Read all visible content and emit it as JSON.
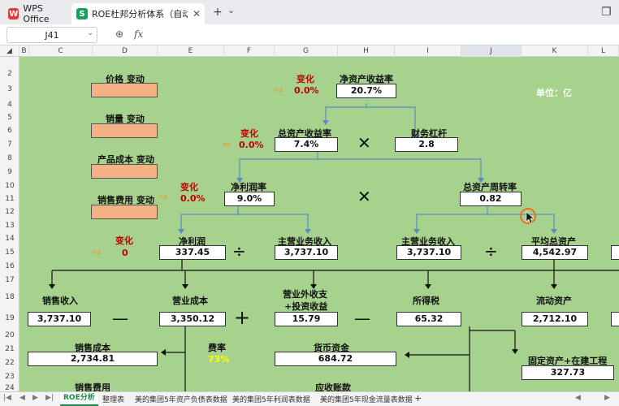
{
  "titlebar": {
    "app_tab": "WPS Office",
    "doc_tab": "ROE杜邦分析体系（自动计算+数",
    "new_tab": "+",
    "dropdown": "⌄",
    "window_icon": "❐"
  },
  "formulabar": {
    "cell_ref": "J41",
    "zoom_icon": "⊕",
    "fx_label": "fx"
  },
  "columns": [
    "B",
    "C",
    "D",
    "E",
    "F",
    "G",
    "H",
    "I",
    "J",
    "K",
    "L"
  ],
  "rows": [
    "2",
    "3",
    "4",
    "5",
    "6",
    "7",
    "8",
    "9",
    "10",
    "11",
    "12",
    "13",
    "14",
    "15",
    "16",
    "17",
    "18",
    "19",
    "20",
    "21",
    "22",
    "23",
    "24"
  ],
  "sheet": {
    "price_change_label": "价格 变动",
    "volume_change_label": "销量 变动",
    "cost_change_label": "产品成本 变动",
    "selling_change_label": "销售费用 变动",
    "change_label": "变化",
    "roe_change": "0.0%",
    "roa_change": "0.0%",
    "npm_change": "0.0%",
    "np_change": "0",
    "roe_label": "净资产收益率",
    "roe_value": "20.7%",
    "unit_label": "单位：亿",
    "roa_label": "总资产收益率",
    "roa_value": "7.4%",
    "leverage_label": "财务杠杆",
    "leverage_value": "2.8",
    "npm_label": "净利润率",
    "npm_value": "9.0%",
    "turnover_label": "总资产周转率",
    "turnover_value": "0.82",
    "np_label": "净利润",
    "np_value": "337.45",
    "rev1_label": "主营业务收入",
    "rev1_value": "3,737.10",
    "rev2_label": "主营业务收入",
    "rev2_value": "3,737.10",
    "avg_assets_label": "平均总资产",
    "avg_assets_value": "4,542.97",
    "sales_label": "销售收入",
    "sales_value": "3,737.10",
    "opcost_label": "营业成本",
    "opcost_value": "3,350.12",
    "nonop_label1": "营业外收支",
    "nonop_label2": "+投资收益",
    "nonop_value": "15.79",
    "tax_label": "所得税",
    "tax_value": "65.32",
    "current_assets_label": "流动资产",
    "current_assets_value": "2,712.10",
    "cogs_label": "销售成本",
    "cogs_value": "2,734.81",
    "rate_label": "费率",
    "rate_value": "73%",
    "cash_label": "货币资金",
    "cash_value": "684.72",
    "fixed_assets_label": "固定资产+在建工程",
    "fixed_assets_value": "327.73",
    "selling_exp_label": "销售费用",
    "receivables_label": "应收账款",
    "times_op": "✕",
    "divide_op": "÷",
    "minus_op": "—",
    "plus_op": "+",
    "arrow_icon": "⇨"
  },
  "sheettabs": [
    "ROE分析",
    "整理表",
    "美的集团5年资产负债表数据",
    "美的集团5年利润表数据",
    "美的集团5年现金流量表数据",
    "+"
  ],
  "colors": {
    "sheet_bg": "#a7d28d",
    "red_text": "#c00000",
    "input_cell": "#f4b183",
    "connector": "#5b8bc4",
    "active_tab": "#1a8a4a"
  }
}
